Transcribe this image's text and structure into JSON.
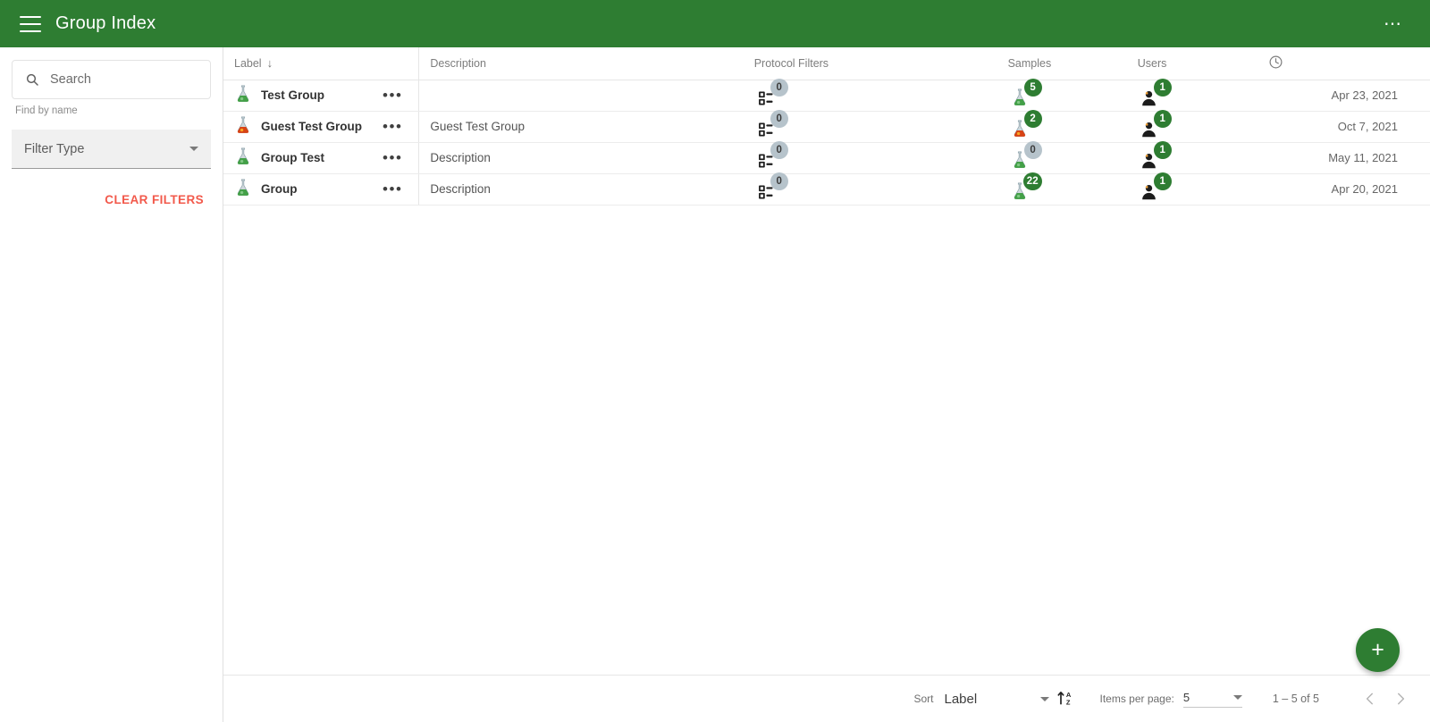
{
  "appbar": {
    "menu_icon": "hamburger-icon",
    "title": "Group Index",
    "overflow_icon": "more-horizontal-icon",
    "background": "#2e7d32"
  },
  "sidebar": {
    "search": {
      "placeholder": "Search",
      "value": "",
      "icon": "search-icon"
    },
    "hint": "Find by name",
    "filter_type": {
      "label": "Filter Type",
      "icon": "chevron-down-icon"
    },
    "clear_filters": "CLEAR FILTERS",
    "clear_filters_color": "#f2594b"
  },
  "table": {
    "headers": {
      "label": "Label",
      "sort_arrow": "↓",
      "description": "Description",
      "protocol_filters": "Protocol Filters",
      "samples": "Samples",
      "users": "Users",
      "date_icon": "clock-icon"
    },
    "rows": [
      {
        "icon": "flask-green-icon",
        "label": "Test Group",
        "menu": "•••",
        "description": "",
        "protocol_filters": "0",
        "samples": "5",
        "samples_icon": "flask-green-icon",
        "users": "1",
        "date": "Apr 23, 2021"
      },
      {
        "icon": "flask-red-icon",
        "label": "Guest Test Group",
        "menu": "•••",
        "description": "Guest Test Group",
        "protocol_filters": "0",
        "samples": "2",
        "samples_icon": "flask-red-icon",
        "users": "1",
        "date": "Oct 7, 2021"
      },
      {
        "icon": "flask-green-icon",
        "label": "Group Test",
        "menu": "•••",
        "description": "Description",
        "protocol_filters": "0",
        "samples": "0",
        "samples_icon": "flask-green-icon",
        "users": "1",
        "date": "May 11, 2021"
      },
      {
        "icon": "flask-green-icon",
        "label": "Group",
        "menu": "•••",
        "description": "Description",
        "protocol_filters": "0",
        "samples": "22",
        "samples_icon": "flask-green-icon",
        "users": "1",
        "date": "Apr 20, 2021"
      }
    ]
  },
  "fab": {
    "label": "+",
    "color": "#2e7d32"
  },
  "footer": {
    "sort_label": "Sort",
    "sort_value": "Label",
    "sort_direction_icon": "sort-az-icon",
    "items_per_page_label": "Items per page:",
    "items_per_page_value": "5",
    "range": "1 – 5 of 5",
    "prev_icon": "chevron-left-icon",
    "next_icon": "chevron-right-icon"
  }
}
